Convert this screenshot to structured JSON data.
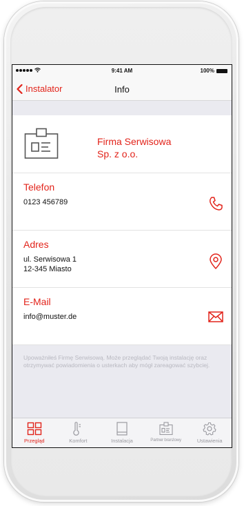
{
  "status_bar": {
    "time": "9:41 AM",
    "battery": "100%"
  },
  "nav": {
    "back_label": "Instalator",
    "title": "Info"
  },
  "company": {
    "name_line1": "Firma Serwisowa",
    "name_line2": "Sp. z o.o."
  },
  "phone": {
    "label": "Telefon",
    "value": "0123 456789"
  },
  "address": {
    "label": "Adres",
    "line1": "ul. Serwisowa 1",
    "line2": "12-345 Miasto"
  },
  "email": {
    "label": "E-Mail",
    "value": "info@muster.de"
  },
  "note": "Upoważniłeś Firmę Serwisową. Może przeglądać Twoją instalację oraz otrzymywać powiadomienia o usterkach aby mógł zareagować szybciej.",
  "tabs": [
    {
      "label": "Przegląd",
      "icon": "grid-icon",
      "active": true
    },
    {
      "label": "Komfort",
      "icon": "thermometer-icon",
      "active": false
    },
    {
      "label": "Instalacja",
      "icon": "device-icon",
      "active": false
    },
    {
      "label": "Partner branżowy",
      "icon": "id-card-icon",
      "active": false
    },
    {
      "label": "Ustawienia",
      "icon": "gear-icon",
      "active": false
    }
  ],
  "colors": {
    "accent": "#e2231a",
    "background": "#eaeaf0",
    "muted": "#9a9aa0"
  }
}
